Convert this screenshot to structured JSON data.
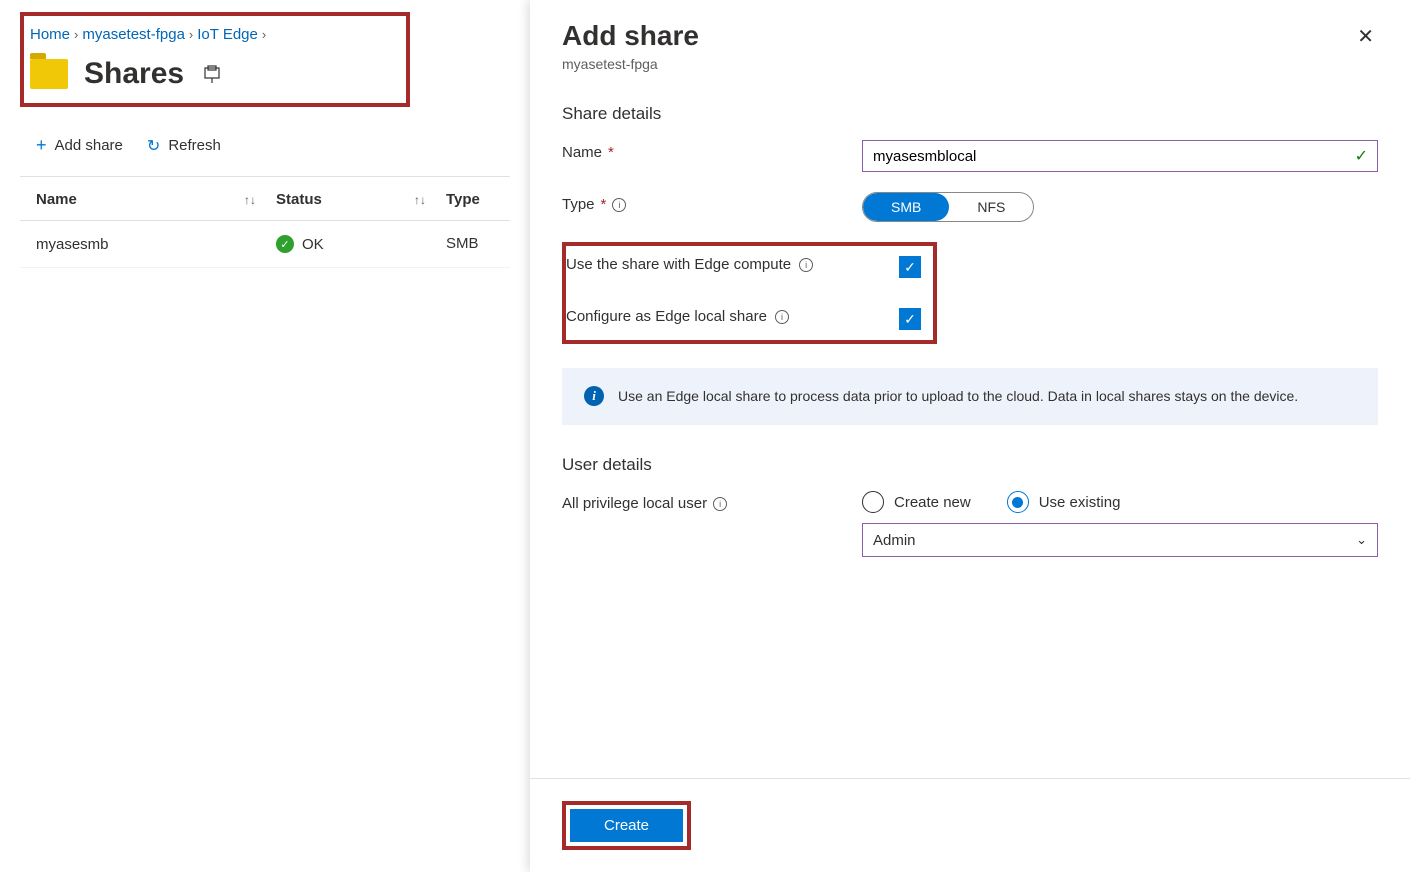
{
  "breadcrumb": {
    "home": "Home",
    "device": "myasetest-fpga",
    "section": "IoT Edge"
  },
  "page": {
    "title": "Shares"
  },
  "toolbar": {
    "add_share": "Add share",
    "refresh": "Refresh"
  },
  "table": {
    "headers": {
      "name": "Name",
      "status": "Status",
      "type": "Type"
    },
    "rows": [
      {
        "name": "myasesmb",
        "status": "OK",
        "type": "SMB"
      }
    ]
  },
  "panel": {
    "title": "Add share",
    "subtitle": "myasetest-fpga",
    "share_details_heading": "Share details",
    "name_label": "Name",
    "name_value": "myasesmblocal",
    "type_label": "Type",
    "type_options": {
      "smb": "SMB",
      "nfs": "NFS"
    },
    "use_edge_compute": "Use the share with Edge compute",
    "configure_local": "Configure as Edge local share",
    "info_text": "Use an Edge local share to process data prior to upload to the cloud. Data in local shares stays on the device.",
    "user_details_heading": "User details",
    "privilege_label": "All privilege local user",
    "create_new": "Create new",
    "use_existing": "Use existing",
    "user_select": "Admin",
    "create_button": "Create"
  }
}
